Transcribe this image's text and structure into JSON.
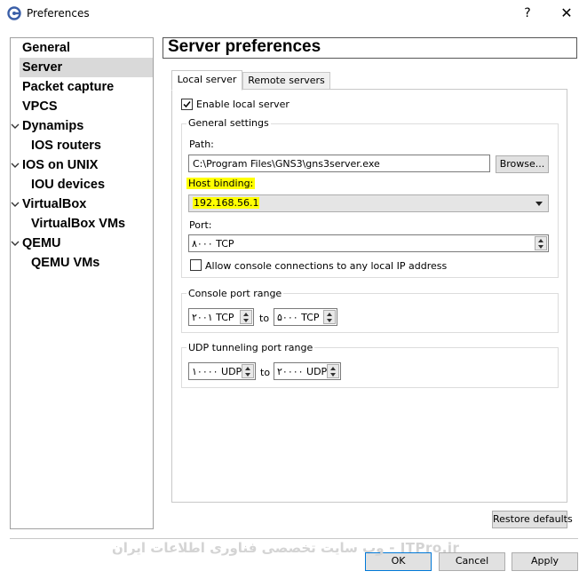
{
  "window": {
    "title": "Preferences",
    "help": "?",
    "close": "✕"
  },
  "sidebar": {
    "items": [
      {
        "label": "General"
      },
      {
        "label": "Server"
      },
      {
        "label": "Packet capture"
      },
      {
        "label": "VPCS"
      },
      {
        "label": "Dynamips"
      },
      {
        "label": "IOS routers"
      },
      {
        "label": "IOS on UNIX"
      },
      {
        "label": "IOU devices"
      },
      {
        "label": "VirtualBox"
      },
      {
        "label": "VirtualBox VMs"
      },
      {
        "label": "QEMU"
      },
      {
        "label": "QEMU VMs"
      }
    ]
  },
  "header": {
    "title": "Server preferences"
  },
  "tabs": [
    {
      "label": "Local server"
    },
    {
      "label": "Remote servers"
    }
  ],
  "local": {
    "enable_label": "Enable local server",
    "general_title": "General settings",
    "path_label": "Path:",
    "path_value": "C:\\Program Files\\GNS3\\gns3server.exe",
    "browse_label": "Browse...",
    "host_label": "Host binding:",
    "host_value": "192.168.56.1",
    "port_label": "Port:",
    "port_value": "۸۰۰۰ TCP",
    "allow_label": "Allow console connections to any local IP address",
    "console_title": "Console port range",
    "console_from": "۲۰۰۱ TCP",
    "console_to": "۵۰۰۰ TCP",
    "to_label": "to",
    "udp_title": "UDP tunneling port range",
    "udp_from": "۱۰۰۰۰ UDP",
    "udp_to": "۲۰۰۰۰ UDP"
  },
  "footer": {
    "restore_label": "Restore defaults",
    "ok_label": "OK",
    "cancel_label": "Cancel",
    "apply_label": "Apply",
    "watermark": "ITPro.ir - وب سایت تخصصی فناوری اطلاعات ایران"
  },
  "colors": {
    "highlight": "#ffff00",
    "selected_nav": "#d9d9d9"
  }
}
